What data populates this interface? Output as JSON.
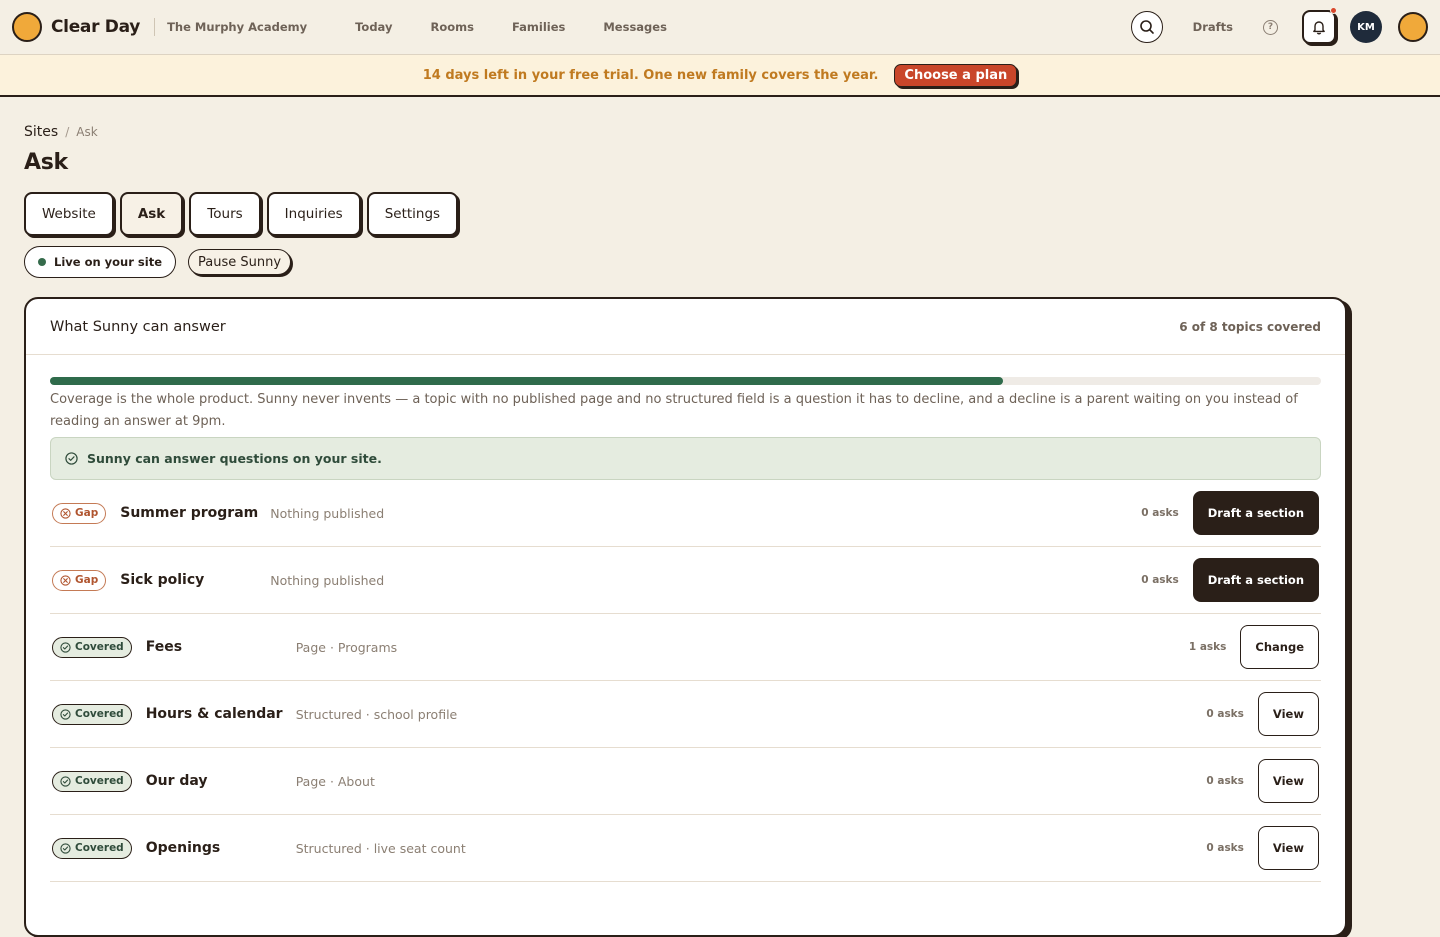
{
  "header": {
    "brand": "Clear Day",
    "school": "The Murphy Academy",
    "nav": [
      "Today",
      "Rooms",
      "Families",
      "Messages"
    ],
    "drafts": "Drafts",
    "help_glyph": "?",
    "avatar_initials": "KM"
  },
  "trial": {
    "text": "14 days left in your free trial. One new family covers the year.",
    "cta": "Choose a plan"
  },
  "breadcrumb": {
    "root": "Sites",
    "sep": "/",
    "current": "Ask"
  },
  "page_title": "Ask",
  "tabs": [
    {
      "label": "Website",
      "active": false
    },
    {
      "label": "Ask",
      "active": true
    },
    {
      "label": "Tours",
      "active": false
    },
    {
      "label": "Inquiries",
      "active": false
    },
    {
      "label": "Settings",
      "active": false
    }
  ],
  "status": {
    "live": "Live on your site",
    "pause": "Pause Sunny"
  },
  "coverage": {
    "title": "What Sunny can answer",
    "count_label": "6 of 8 topics covered",
    "covered": 6,
    "total": 8,
    "progress_fraction": 0.75,
    "description": "Coverage is the whole product. Sunny never invents — a topic with no published page and no structured field is a question it has to decline, and a decline is a parent waiting on you instead of reading an answer at 9pm.",
    "banner": "Sunny can answer questions on your site."
  },
  "topics": [
    {
      "status": "Gap",
      "name": "Summer program",
      "source": "Nothing published",
      "asks": "0 asks",
      "action": "Draft a section"
    },
    {
      "status": "Gap",
      "name": "Sick policy",
      "source": "Nothing published",
      "asks": "0 asks",
      "action": "Draft a section"
    },
    {
      "status": "Covered",
      "name": "Fees",
      "source": "Page · Programs",
      "asks": "1 asks",
      "action": "Change"
    },
    {
      "status": "Covered",
      "name": "Hours & calendar",
      "source": "Structured · school profile",
      "asks": "0 asks",
      "action": "View"
    },
    {
      "status": "Covered",
      "name": "Our day",
      "source": "Page · About",
      "asks": "0 asks",
      "action": "View"
    },
    {
      "status": "Covered",
      "name": "Openings",
      "source": "Structured · live seat count",
      "asks": "0 asks",
      "action": "View"
    }
  ],
  "colors": {
    "page_bg": "#f4efe4",
    "ink": "#2a1f18",
    "accent_orange": "#f0a93a",
    "cta_red": "#c9462a",
    "progress_green": "#2f6b4b",
    "gap": "#b0552f"
  }
}
